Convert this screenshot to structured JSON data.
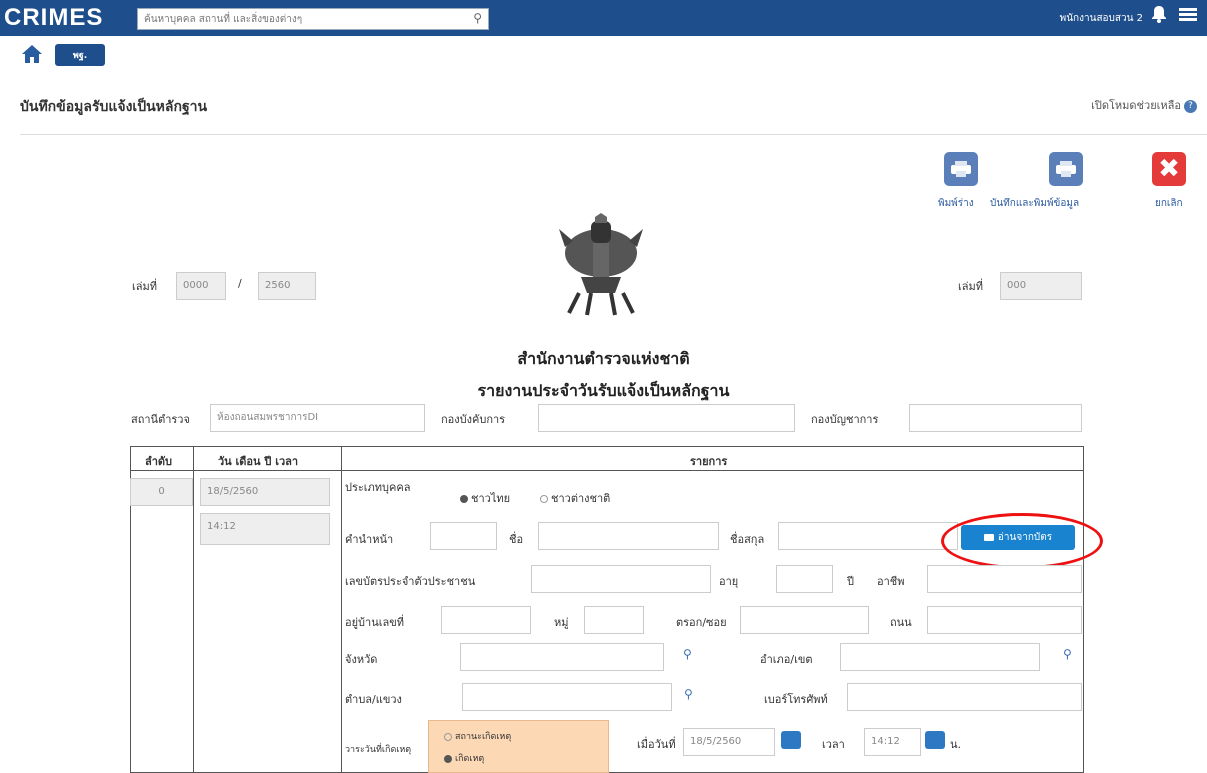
{
  "app": {
    "logo": "CRIMES",
    "search_placeholder": "ค้นหาบุคคล สถานที่ และสิ่งของต่างๆ",
    "user_label": "พนักงานสอบสวน 2",
    "menu_button": "พฐ."
  },
  "page": {
    "title": "บันทึกข้อมูลรับแจ้งเป็นหลักฐาน",
    "help": "เปิดโหมดช่วยเหลือ"
  },
  "toolbar": {
    "draft_print": "พิมพ์ร่าง",
    "save_print": "บันทึกและพิมพ์ข้อมูล",
    "cancel": "ยกเลิก"
  },
  "doc": {
    "number_label_left": "เล่มที่",
    "number_left": "0000",
    "slash": "/",
    "year_left": "2560",
    "number_label_right": "เล่มที่",
    "number_right": "000",
    "org": "สำนักงานตำรวจแห่งชาติ",
    "report_title": "รายงานประจำวันรับแจ้งเป็นหลักฐาน",
    "station_label": "สถานีตำรวจ",
    "station_value": "ห้องถอนสมพรชาการDI",
    "division_label": "กองบังคับการ",
    "command_label": "กองบัญชาการ"
  },
  "table": {
    "col_seq": "ลำดับ",
    "col_date": "วัน เดือน ปี เวลา",
    "col_items": "รายการ",
    "seq_value": "0",
    "date_value": "18/5/2560",
    "time_value": "14:12"
  },
  "form": {
    "person_type_label": "ประเภทบุคคล",
    "opt_thai": "ชาวไทย",
    "opt_foreign": "ชาวต่างชาติ",
    "prefix_label": "คำนำหน้า",
    "name_label": "ชื่อ",
    "surname_label": "ชื่อสกุล",
    "read_card_button": "อ่านจากบัตร",
    "id_label": "เลขบัตรประจำตัวประชาชน",
    "age_label": "อายุ",
    "year_unit": "ปี",
    "occupation_label": "อาชีพ",
    "address_label": "อยู่บ้านเลขที่",
    "moo_label": "หมู่",
    "soi_label": "ตรอก/ซอย",
    "road_label": "ถนน",
    "province_label": "จังหวัด",
    "district_label": "อำเภอ/เขต",
    "subdistrict_label": "ตำบล/แขวง",
    "phone_label": "เบอร์โทรศัพท์",
    "incident_label": "วาระวันที่เกิดเหตุ",
    "opt_unknown": "สถานะเกิดเหตุ",
    "opt_known": "เกิดเหตุ",
    "when_label": "เมื่อวันที่",
    "when_date": "18/5/2560",
    "time_label": "เวลา",
    "time_value": "14:12",
    "time_unit": "น."
  }
}
